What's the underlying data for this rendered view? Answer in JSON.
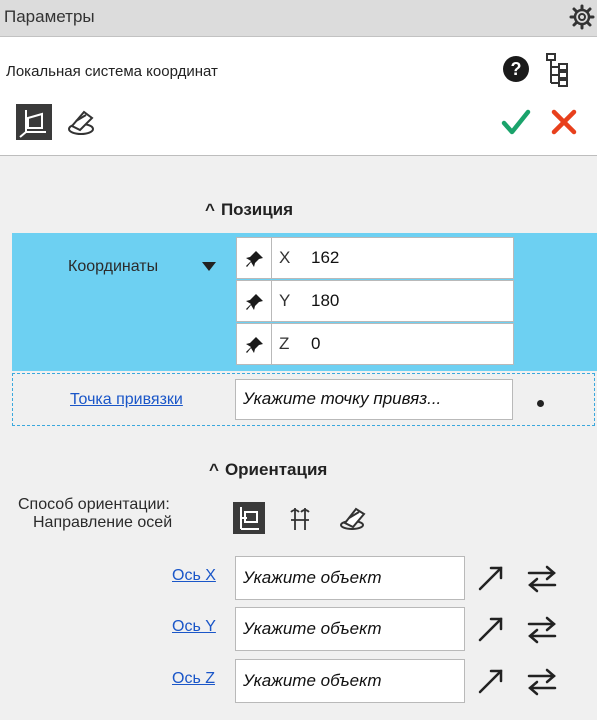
{
  "window": {
    "title": "Параметры",
    "subtitle": "Локальная система координат"
  },
  "colors": {
    "highlight": "#6dd0f2",
    "accept": "#1aa36b",
    "cancel": "#e8401c",
    "link": "#1a56c8"
  },
  "toolbar": {
    "icons": [
      "lcs-icon",
      "cut-plane-icon",
      "help-icon",
      "tree-icon",
      "ok-icon",
      "cancel-icon"
    ]
  },
  "position": {
    "header": "Позиция",
    "coords_label": "Координаты",
    "rows": [
      {
        "axis": "X",
        "value": "162"
      },
      {
        "axis": "Y",
        "value": "180"
      },
      {
        "axis": "Z",
        "value": "0"
      }
    ],
    "anchor_link": "Точка привязки",
    "anchor_placeholder": "Укажите точку привяз..."
  },
  "orientation": {
    "header": "Ориентация",
    "method_label": "Способ ориентации:",
    "method_value": "Направление осей",
    "axes": [
      {
        "link": "Ось X",
        "placeholder": "Укажите объект"
      },
      {
        "link": "Ось Y",
        "placeholder": "Укажите объект"
      },
      {
        "link": "Ось Z",
        "placeholder": "Укажите объект"
      }
    ]
  }
}
